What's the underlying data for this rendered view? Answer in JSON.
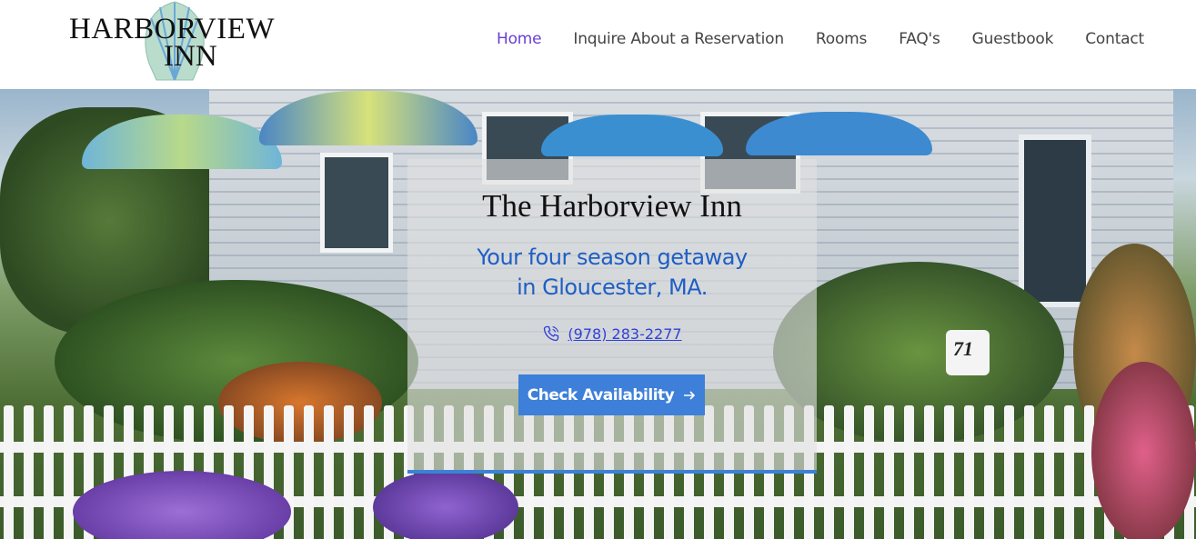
{
  "logo": {
    "line1": "HARBORVIEW",
    "line2": "INN"
  },
  "nav": {
    "items": [
      {
        "label": "Home",
        "active": true
      },
      {
        "label": "Inquire About a Reservation",
        "active": false
      },
      {
        "label": "Rooms",
        "active": false
      },
      {
        "label": "FAQ's",
        "active": false
      },
      {
        "label": "Guestbook",
        "active": false
      },
      {
        "label": "Contact",
        "active": false
      }
    ]
  },
  "hero": {
    "title": "The Harborview Inn",
    "subtitle_line1": "Your four season getaway",
    "subtitle_line2": "in Gloucester, MA.",
    "phone": "(978) 283-2277",
    "phone_icon": "phone-icon",
    "cta_label": "Check Availability",
    "cta_icon": "arrow-right-icon",
    "mailbox_number": "71"
  },
  "colors": {
    "accent": "#3d7fd9",
    "nav_active": "#6a3fd0",
    "subtitle": "#1f5ec4"
  }
}
